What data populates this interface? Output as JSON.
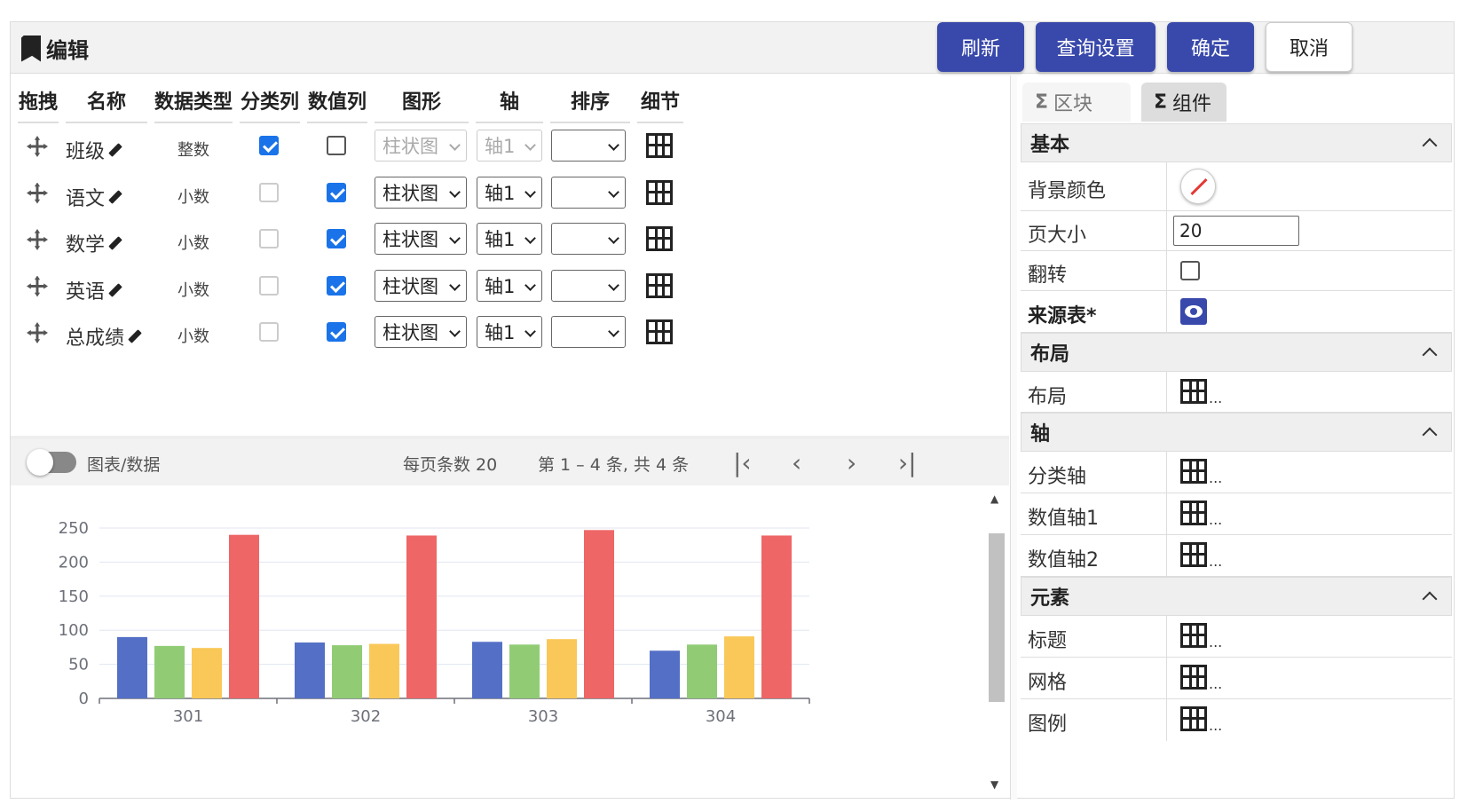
{
  "header": {
    "title": "编辑",
    "buttons": {
      "refresh": "刷新",
      "query_settings": "查询设置",
      "ok": "确定",
      "cancel": "取消"
    }
  },
  "grid": {
    "columns": [
      "拖拽",
      "名称",
      "数据类型",
      "分类列",
      "数值列",
      "图形",
      "轴",
      "排序",
      "细节"
    ],
    "rows": [
      {
        "name": "班级",
        "type": "整数",
        "category": true,
        "value": false,
        "shape": "柱状图",
        "axis": "轴1",
        "sort": "",
        "disabled": true
      },
      {
        "name": "语文",
        "type": "小数",
        "category": false,
        "value": true,
        "shape": "柱状图",
        "axis": "轴1",
        "sort": "",
        "disabled": false
      },
      {
        "name": "数学",
        "type": "小数",
        "category": false,
        "value": true,
        "shape": "柱状图",
        "axis": "轴1",
        "sort": "",
        "disabled": false
      },
      {
        "name": "英语",
        "type": "小数",
        "category": false,
        "value": true,
        "shape": "柱状图",
        "axis": "轴1",
        "sort": "",
        "disabled": false
      },
      {
        "name": "总成绩",
        "type": "小数",
        "category": false,
        "value": true,
        "shape": "柱状图",
        "axis": "轴1",
        "sort": "",
        "disabled": false
      }
    ]
  },
  "pager": {
    "toggle_label": "图表/数据",
    "page_size_label": "每页条数 20",
    "range_label": "第 1 – 4 条, 共 4 条"
  },
  "tabs": [
    "区块",
    "组件"
  ],
  "properties": {
    "sections": [
      "基本",
      "布局",
      "轴",
      "元素"
    ],
    "bg_color": "背景颜色",
    "page_size": "页大小",
    "page_size_value": "20",
    "flip": "翻转",
    "source_table": "来源表*",
    "layout": "布局",
    "category_axis": "分类轴",
    "value_axis1": "数值轴1",
    "value_axis2": "数值轴2",
    "title": "标题",
    "grid": "网格",
    "legend": "图例",
    "ellipsis": "..."
  },
  "chart_data": {
    "type": "bar",
    "categories": [
      "301",
      "302",
      "303",
      "304"
    ],
    "series": [
      {
        "values": [
          90,
          82,
          83,
          70
        ],
        "color": "#5470c6"
      },
      {
        "values": [
          77,
          78,
          79,
          79
        ],
        "color": "#91cc75"
      },
      {
        "values": [
          74,
          80,
          87,
          91
        ],
        "color": "#fac858"
      },
      {
        "values": [
          240,
          239,
          247,
          239
        ],
        "color": "#ee6666"
      }
    ],
    "ylim": [
      0,
      250
    ],
    "yticks": [
      0,
      50,
      100,
      150,
      200,
      250
    ],
    "grid": true
  }
}
